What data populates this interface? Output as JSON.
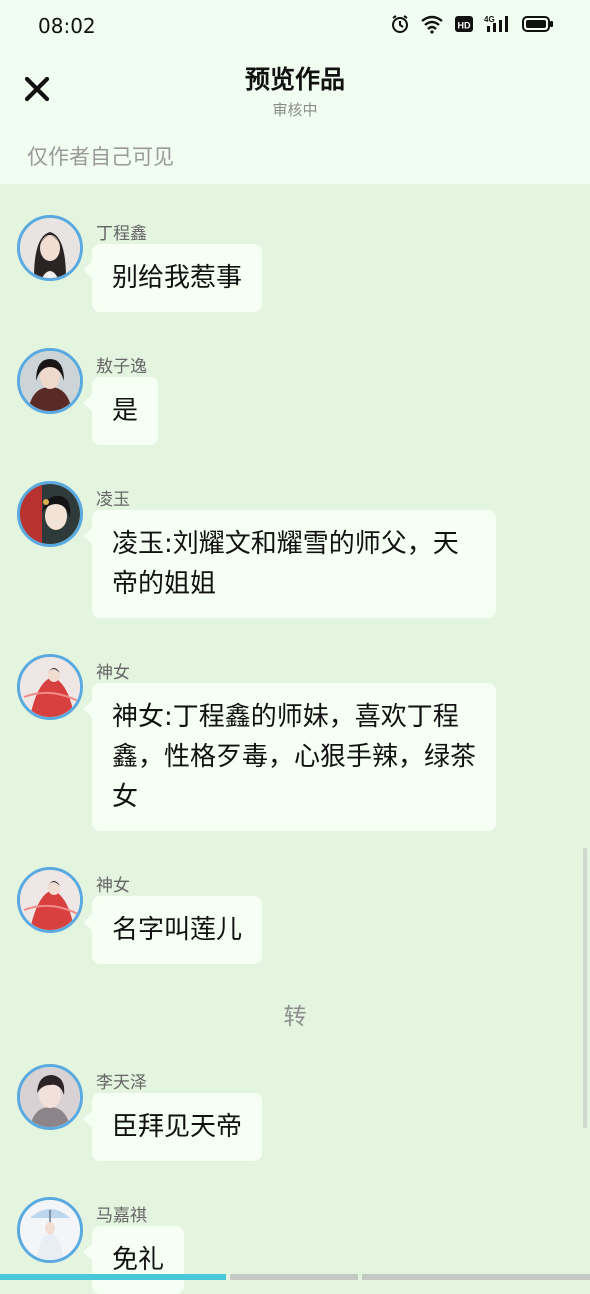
{
  "status_bar": {
    "time": "08:02",
    "icons": [
      "alarm-icon",
      "wifi-icon",
      "hd-icon",
      "signal-4g-icon",
      "battery-icon"
    ],
    "network_label": "4G",
    "hd_label": "HD"
  },
  "header": {
    "title": "预览作品",
    "subtitle": "审核中",
    "notice": "仅作者自己可见",
    "close_icon": "close-icon"
  },
  "messages": [
    {
      "name": "丁程鑫",
      "text": "别给我惹事"
    },
    {
      "name": "敖子逸",
      "text": "是"
    },
    {
      "name": "凌玉",
      "text": "凌玉:刘耀文和耀雪的师父，天帝的姐姐"
    },
    {
      "name": "神女",
      "text": "神女:丁程鑫的师妹，喜欢丁程鑫，性格歹毒，心狠手辣，绿茶女"
    },
    {
      "name": "神女",
      "text": "名字叫莲儿"
    },
    {
      "name": "李天泽",
      "text": "臣拜见天帝"
    },
    {
      "name": "马嘉祺",
      "text": "免礼"
    }
  ],
  "divider": "转",
  "colors": {
    "header_bg": "#f1fdf0",
    "chat_bg": "#e3f4df",
    "bubble_bg": "#f6fff4",
    "avatar_border": "#5aa9e0",
    "progress_active": "#47c7d8"
  }
}
